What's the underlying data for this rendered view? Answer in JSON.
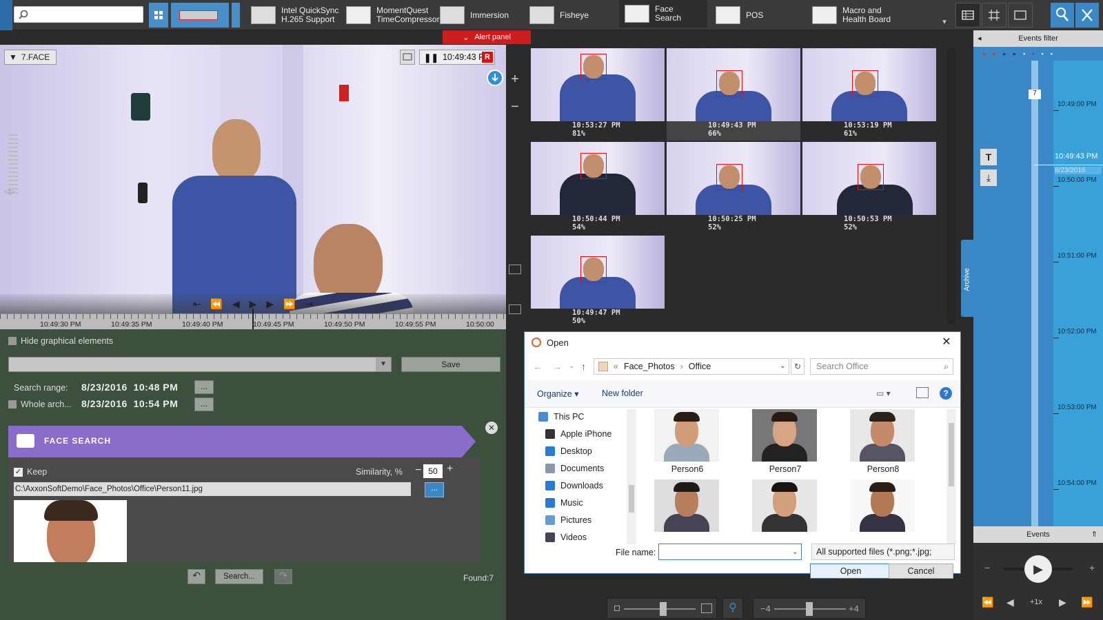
{
  "toolbar": {
    "search_placeholder": "",
    "layouts": [
      {
        "label": "Intel QuickSync\nH.265 Support"
      },
      {
        "label": "MomentQuest\nTimeCompressor"
      },
      {
        "label": "Immersion"
      },
      {
        "label": "Fisheye"
      },
      {
        "label": "Face Search"
      },
      {
        "label": "POS"
      },
      {
        "label": "Macro and\nHealth Board"
      }
    ],
    "alert_panel_label": "Alert panel"
  },
  "camera": {
    "name": "7.FACE",
    "time": "10:49:43 PM",
    "rec_badge": "R",
    "timeline_labels": [
      "10:49:30 PM",
      "10:49:35 PM",
      "10:49:40 PM",
      "10:49:45 PM",
      "10:49:50 PM",
      "10:49:55 PM",
      "10:50:00"
    ]
  },
  "results": [
    {
      "time": "10:53:27 PM",
      "score": "81%"
    },
    {
      "time": "10:49:43 PM",
      "score": "66%"
    },
    {
      "time": "10:53:19 PM",
      "score": "61%"
    },
    {
      "time": "10:50:44 PM",
      "score": "54%"
    },
    {
      "time": "10:50:25 PM",
      "score": "52%"
    },
    {
      "time": "10:50:53 PM",
      "score": "52%"
    },
    {
      "time": "10:49:47 PM",
      "score": "50%"
    }
  ],
  "search_panel": {
    "hide_graphical": "Hide graphical elements",
    "save_label": "Save",
    "search_range_label": "Search range:",
    "search_range_value": "8/23/2016  10:48 PM",
    "whole_archive_label": "Whole arch...",
    "whole_archive_value": "8/23/2016  10:54 PM",
    "ellipsis": "...",
    "face_search_title": "FACE SEARCH",
    "keep_label": "Keep",
    "similarity_label": "Similarity, %",
    "similarity_value": "50",
    "minus": "−",
    "plus": "+",
    "file_path": "C:\\AxxonSoftDemo\\Face_Photos\\Office\\Person11.jpg",
    "search_button": "Search...",
    "found_label": "Found:7"
  },
  "dialog": {
    "title": "Open",
    "breadcrumb_sep": "«",
    "path": [
      "Face_Photos",
      "Office"
    ],
    "search_placeholder": "Search Office",
    "organize": "Organize",
    "new_folder": "New folder",
    "tree": [
      {
        "label": "This PC",
        "icon": "computer-icon"
      },
      {
        "label": "Apple iPhone",
        "icon": "phone-icon"
      },
      {
        "label": "Desktop",
        "icon": "desktop-icon"
      },
      {
        "label": "Documents",
        "icon": "documents-icon"
      },
      {
        "label": "Downloads",
        "icon": "downloads-icon"
      },
      {
        "label": "Music",
        "icon": "music-icon"
      },
      {
        "label": "Pictures",
        "icon": "pictures-icon"
      },
      {
        "label": "Videos",
        "icon": "videos-icon"
      }
    ],
    "files": [
      {
        "label": "Person6"
      },
      {
        "label": "Person7"
      },
      {
        "label": "Person8"
      },
      {
        "label": ""
      },
      {
        "label": ""
      },
      {
        "label": ""
      }
    ],
    "filename_label": "File name:",
    "filename_value": "",
    "filetype": "All supported files (*.png;*.jpg;",
    "open_button": "Open",
    "cancel_button": "Cancel"
  },
  "right_panel": {
    "events_filter": "Events filter",
    "archive_tab": "Archive",
    "marker_count": "7",
    "current_time": "10:49:43 PM",
    "current_date": "8/23/2016",
    "timeline_labels": [
      "10:49:00 PM",
      "10:50:00 PM",
      "10:51:00 PM",
      "10:52:00 PM",
      "10:53:00 PM",
      "10:54:00 PM"
    ],
    "events_label": "Events",
    "speed": "+1x",
    "minus": "−",
    "plus": "+"
  },
  "bottom_controls": {
    "zoom_min": "−4",
    "zoom_max": "+4"
  },
  "colors": {
    "accent_purple": "#8a6cc9",
    "alert_red": "#cc1e1e",
    "timeline_blue": "#3aa0d8"
  }
}
